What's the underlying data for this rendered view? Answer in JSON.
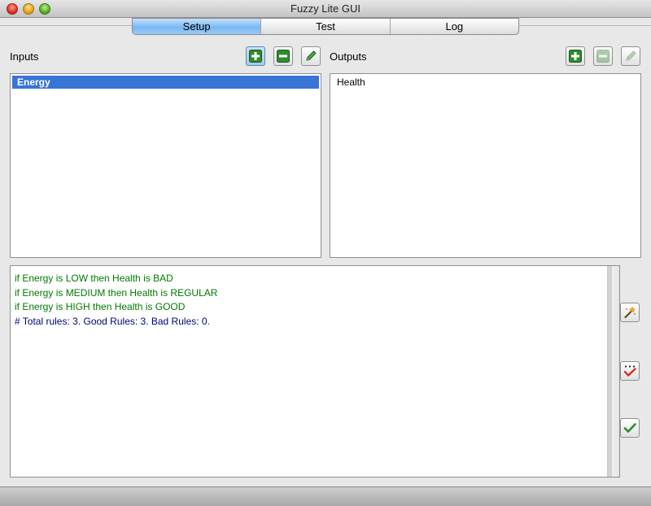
{
  "window": {
    "title": "Fuzzy Lite GUI"
  },
  "tabs": [
    {
      "label": "Setup",
      "active": true
    },
    {
      "label": "Test",
      "active": false
    },
    {
      "label": "Log",
      "active": false
    }
  ],
  "inputs": {
    "label": "Inputs",
    "items": [
      {
        "label": "Energy",
        "selected": true
      }
    ]
  },
  "outputs": {
    "label": "Outputs",
    "items": [
      {
        "label": "Health",
        "selected": false
      }
    ]
  },
  "rules": {
    "lines": [
      "if Energy is LOW then Health is BAD",
      "if Energy is MEDIUM then Health is REGULAR",
      "if Energy is HIGH then Health is GOOD"
    ],
    "summary": "# Total rules: 3. Good Rules: 3. Bad Rules: 0."
  },
  "icons": {
    "add": "plus-icon",
    "remove": "minus-icon",
    "edit": "pencil-icon",
    "wizard": "magic-wand-icon",
    "check_rules": "check-rules-icon",
    "apply": "checkmark-icon"
  },
  "colors": {
    "selection": "#3875d7",
    "rule_text": "#007a00",
    "comment_text": "#00007a",
    "icon_green": "#2e8b2e"
  }
}
